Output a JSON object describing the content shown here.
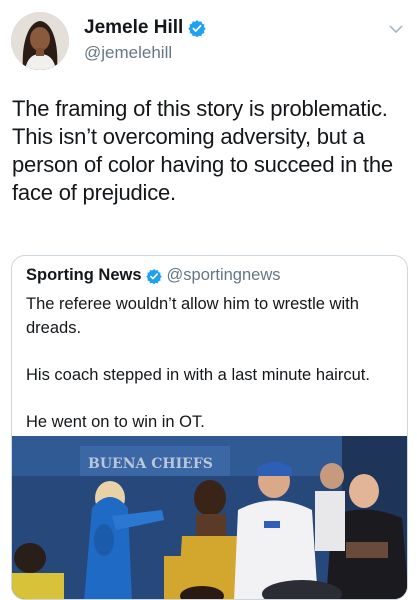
{
  "tweet": {
    "author": {
      "display_name": "Jemele Hill",
      "handle": "@jemelehill",
      "verified": true
    },
    "text": "The framing of this story is problematic. This isn’t overcoming adversity, but a person of color having to succeed in the face of prejudice.",
    "menu_icon": "chevron-down-icon"
  },
  "quoted_tweet": {
    "author": {
      "display_name": "Sporting News",
      "handle": "@sportingnews",
      "verified": true
    },
    "paragraphs": [
      "The referee wouldn’t allow him to wrestle with dreads.",
      "His coach stepped in with a last minute haircut.",
      "He went on to win in OT."
    ],
    "media": {
      "sign_text": "BUENA CHIEFS"
    }
  },
  "colors": {
    "text_primary": "#14171a",
    "text_secondary": "#657786",
    "verified_blue": "#1da1f2",
    "border": "#ccd6dd"
  }
}
